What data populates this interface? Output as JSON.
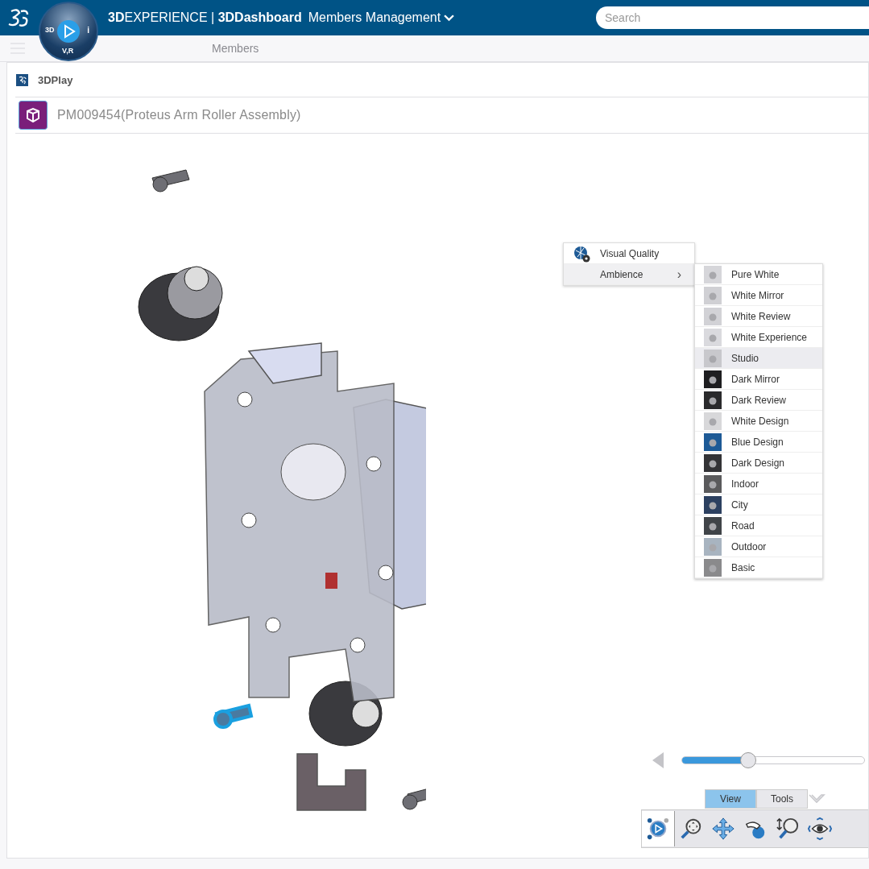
{
  "topbar": {
    "brand_bold": "3D",
    "brand_rest": "EXPERIENCE",
    "separator": "|",
    "app": "3DDashboard",
    "dashboard": "Members Management",
    "search": {
      "placeholder": "Search"
    }
  },
  "compass": {
    "left": "3D",
    "right": "i",
    "bottom": "V,R"
  },
  "subnav": {
    "items": [
      "Members"
    ]
  },
  "widget": {
    "title": "3DPlay",
    "object": "PM009454(Proteus Arm Roller Assembly)"
  },
  "context_menu": {
    "items": [
      {
        "label": "Visual Quality",
        "kind": "icon",
        "selected": false
      },
      {
        "label": "Ambience",
        "kind": "submenu",
        "selected": true,
        "arrow": "›"
      }
    ]
  },
  "ambience_menu": {
    "items": [
      {
        "label": "Pure White",
        "selected": false,
        "color": "#d6d6da"
      },
      {
        "label": "White Mirror",
        "selected": false,
        "color": "#d0d0d4"
      },
      {
        "label": "White Review",
        "selected": false,
        "color": "#d2d2d6"
      },
      {
        "label": "White Experience",
        "selected": false,
        "color": "#dadade"
      },
      {
        "label": "Studio",
        "selected": true,
        "color": "#c8c8cc"
      },
      {
        "label": "Dark Mirror",
        "selected": false,
        "color": "#1e1e20"
      },
      {
        "label": "Dark Review",
        "selected": false,
        "color": "#2a2a2c"
      },
      {
        "label": "White Design",
        "selected": false,
        "color": "#d8d8da"
      },
      {
        "label": "Blue Design",
        "selected": false,
        "color": "#1d5a96"
      },
      {
        "label": "Dark Design",
        "selected": false,
        "color": "#333336"
      },
      {
        "label": "Indoor",
        "selected": false,
        "color": "#5a5a5c"
      },
      {
        "label": "City",
        "selected": false,
        "color": "#2c4060"
      },
      {
        "label": "Road",
        "selected": false,
        "color": "#404448"
      },
      {
        "label": "Outdoor",
        "selected": false,
        "color": "#a8b4c0"
      },
      {
        "label": "Basic",
        "selected": false,
        "color": "#8a8a8c"
      }
    ]
  },
  "slider": {
    "level": 0.36
  },
  "toolbar": {
    "tabs": [
      {
        "label": "View",
        "selected": true
      },
      {
        "label": "Tools",
        "selected": false
      }
    ],
    "tools": [
      {
        "kind": "play",
        "selected": true
      },
      {
        "kind": "zoom-fit",
        "selected": false
      },
      {
        "kind": "pan",
        "selected": false
      },
      {
        "kind": "rotate",
        "selected": false
      },
      {
        "kind": "zoom",
        "selected": false
      },
      {
        "kind": "view",
        "selected": false
      }
    ]
  }
}
